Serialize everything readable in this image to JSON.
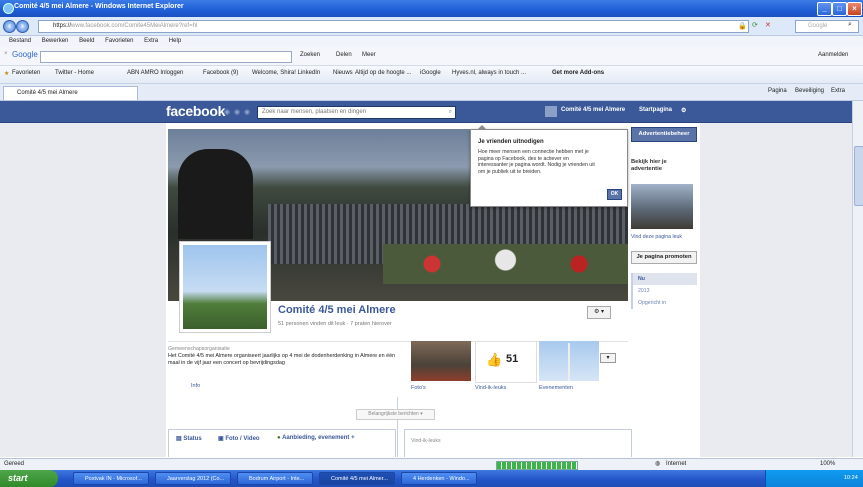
{
  "window": {
    "title": "Comité 4/5 mei Almere - Windows Internet Explorer"
  },
  "address": {
    "url_prefix": "https",
    "url_domain": "www.facebook.com",
    "url_path": "/Comite45MeiAlmere?ref=hl",
    "search_placeholder": "Google"
  },
  "menubar": [
    "Bestand",
    "Bewerken",
    "Beeld",
    "Favorieten",
    "Extra",
    "Help"
  ],
  "google_toolbar": {
    "brand": "Google",
    "search_label": "Zoeken",
    "share_label": "Delen",
    "more_label": "Meer",
    "signin": "Aanmelden"
  },
  "favorites": {
    "label": "Favorieten",
    "items": [
      "Twitter - Home",
      "ABN AMRO Inloggen",
      "Facebook (9)",
      "Welcome, Shira! LinkedIn",
      "Nieuws",
      "Altijd op de hoogte ...",
      "iGoogle",
      "Hyves.nl, always in touch ...",
      "Get more Add-ons"
    ]
  },
  "tab": {
    "label": "Comité 4/5 mei Almere"
  },
  "command_bar": {
    "page": "Pagina",
    "security": "Beveiliging",
    "extra": "Extra"
  },
  "facebook": {
    "logo": "facebook",
    "search_placeholder": "Zoek naar mensen, plaatsen en dingen",
    "nav_page": "Comité 4/5 mei Almere",
    "nav_home": "Startpagina",
    "page_name": "Comité 4/5 mei Almere",
    "likes_line": "51 personen vinden dit leuk · 7 praten hierover",
    "category": "Gemeenschapsorganisatie",
    "about": "Het Comité 4/5 mei Almere organiseert jaarlijks op 4 mei de dodenherdenking in Almere en één maal in de vijf jaar een concert op bevrijdingsdag",
    "info_link": "Info",
    "tile_photos": "Foto's",
    "tile_likes": "Vind-ik-leuks",
    "tile_events": "Evenementen",
    "like_count": "51",
    "highlights": "Belangrijkste berichten",
    "composer": {
      "status": "Status",
      "photo": "Foto / Video",
      "offer": "Aanbieding, evenement +"
    },
    "likes_box": "Vind-ik-leuks",
    "invite": {
      "title": "Je vrienden uitnodigen",
      "body": "Hoe meer mensen een connectie hebben met je pagina op Facebook, des te actiever en interessanter je pagina wordt. Nodig je vrienden uit om je publiek uit te breiden.",
      "ok": "OK"
    },
    "right": {
      "ad_button": "Advertentiebeheer",
      "ad_title": "Bekijk hier je advertentie",
      "ad_like": "Vind deze pagina leuk",
      "promote": "Je pagina promoten",
      "years": [
        "Nu",
        "2013",
        "Opgericht in"
      ]
    }
  },
  "statusbar": {
    "left": "Gereed",
    "zone": "Internet",
    "zoom": "100%"
  },
  "taskbar": {
    "start": "start",
    "tasks": [
      "Postvak IN - Microsof...",
      "Jaarverslag 2012 (Co...",
      "Bodrum Airport - Inte...",
      "Comité 4/5 mei Almer...",
      "4 Herdenken - Windo..."
    ],
    "clock": "10:24"
  }
}
